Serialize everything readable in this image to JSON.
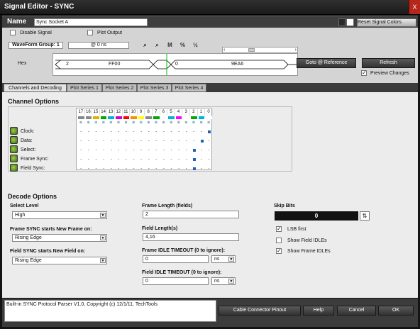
{
  "window": {
    "title": "Signal Editor - SYNC",
    "close_label": "X"
  },
  "name_bar": {
    "label": "Name",
    "value": "Sync Socket A",
    "reset_label": "Reset Signal Colors"
  },
  "options": {
    "disable_signal": "Disable Signal",
    "plot_output": "Plot Output",
    "waveform_group": "WaveForm Group: 1",
    "time_field": "@ 0 ns"
  },
  "waveform": {
    "label": "Hex",
    "segments": [
      "2",
      "FF00",
      "0",
      "9EA6"
    ]
  },
  "actions": {
    "goto_ref": "Goto @ Reference",
    "refresh": "Refresh",
    "preview_changes": "Preview Changes"
  },
  "tabs": [
    {
      "label": "Channels and Decoding"
    },
    {
      "label": "Plot Series 1"
    },
    {
      "label": "Plot Series 2"
    },
    {
      "label": "Plot Series 3"
    },
    {
      "label": "Plot Series 4"
    }
  ],
  "channel_options": {
    "heading": "Channel Options",
    "bits": [
      "17",
      "16",
      "15",
      "14",
      "13",
      "12",
      "11",
      "10",
      "9",
      "8",
      "7",
      "6",
      "5",
      "4",
      "3",
      "2",
      "1",
      "0"
    ],
    "bit_colors": [
      "#888888",
      "#888888",
      "#e0b000",
      "#00aa00",
      "#00b0e0",
      "#d000d0",
      "#ff0000",
      "#ff8c00",
      "#ffff00",
      "#888888",
      "#00aa00",
      "#ffffff",
      "#00b0e0",
      "#ff00ff",
      "#ffffff",
      "#00aa00",
      "#00b0e0",
      "#ffffff"
    ],
    "rows": [
      {
        "label": "Clock:",
        "marked": 17
      },
      {
        "label": "Data:",
        "marked": 16
      },
      {
        "label": "Select:",
        "marked": 15
      },
      {
        "label": "Frame Sync:",
        "marked": 15
      },
      {
        "label": "Field Sync:",
        "marked": 15
      }
    ]
  },
  "decode": {
    "heading": "Decode Options",
    "select_level_label": "Select Level",
    "select_level_value": "High",
    "frame_sync_label": "Frame SYNC starts New Frame on:",
    "frame_sync_value": "Rising Edge",
    "field_sync_label": "Field SYNC starts New Field on:",
    "field_sync_value": "Rising Edge",
    "frame_length_label": "Frame Length (fields)",
    "frame_length_value": "2",
    "field_length_label": "Field Length(s)",
    "field_length_value": "4,16",
    "frame_idle_label": "Frame IDLE TIMEOUT (0 to ignore):",
    "frame_idle_value": "0",
    "frame_idle_unit": "ns",
    "field_idle_label": "Field IDLE TIMEOUT (0 to ignore):",
    "field_idle_value": "0",
    "field_idle_unit": "ns",
    "skip_bits_label": "Skip Bits",
    "skip_bits_value": "0",
    "lsb_first": "LSB first",
    "show_field_idles": "Show Field IDLEs",
    "show_frame_idles": "Show Frame IDLEs"
  },
  "footer": {
    "status": "Built-in SYNC Protocol Parser V1.0,  Copyright (c) 12/1/11, TechTools",
    "cable_btn": "Cable Connector Pinout",
    "help_btn": "Help",
    "cancel_btn": "Cancel",
    "ok_btn": "OK"
  }
}
